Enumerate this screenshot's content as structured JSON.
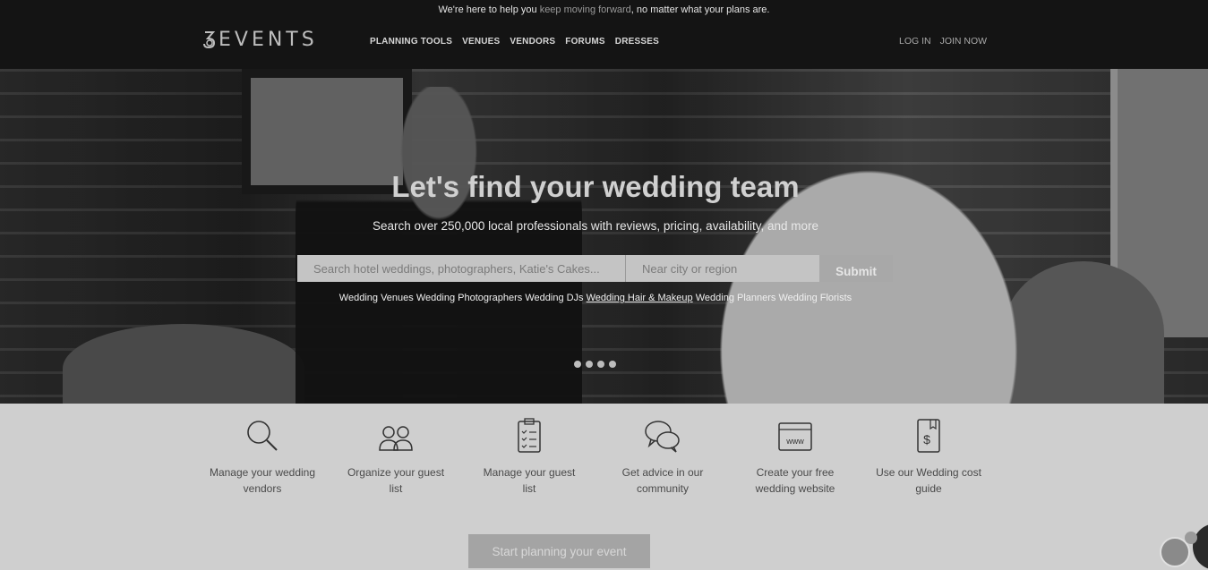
{
  "header": {
    "banner_pre": "We're here to help you ",
    "banner_highlight": "keep moving forward",
    "banner_post": ", no matter what your plans are.",
    "logo_text": "EVENTS",
    "nav": [
      "PLANNING TOOLS",
      "VENUES",
      "VENDORS",
      "FORUMS",
      "DRESSES"
    ],
    "login": "LOG IN",
    "join": "JOIN NOW"
  },
  "hero": {
    "title": "Let's find your wedding team",
    "subtitle": "Search over 250,000 local professionals with reviews, pricing, availability, and more",
    "search_placeholder": "Search hotel weddings, photographers, Katie's Cakes...",
    "location_placeholder": "Near city or region",
    "submit_label": "Submit",
    "quick_links": [
      "Wedding Venues",
      "Wedding Photographers",
      "Wedding DJs",
      "Wedding Hair & Makeup",
      "Wedding Planners",
      "Wedding Florists"
    ],
    "slide_count": 4
  },
  "features": [
    {
      "icon": "magnifier-icon",
      "label": "Manage your wedding vendors"
    },
    {
      "icon": "guests-icon",
      "label": "Organize your guest list"
    },
    {
      "icon": "clipboard-icon",
      "label": "Manage your guest list"
    },
    {
      "icon": "chat-bubbles-icon",
      "label": "Get advice in our community"
    },
    {
      "icon": "website-icon",
      "label": "Create your free wedding website"
    },
    {
      "icon": "cost-guide-icon",
      "label": "Use our Wedding cost guide"
    }
  ],
  "cta_label": "Start planning your event"
}
